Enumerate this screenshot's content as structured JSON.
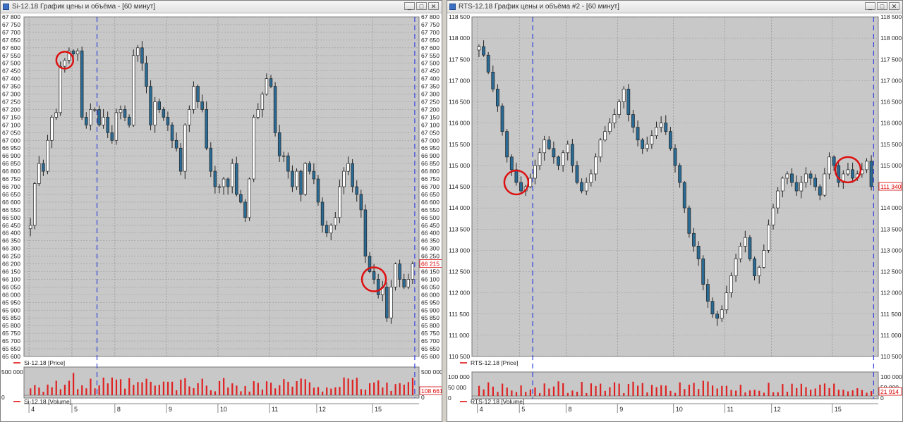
{
  "windows": [
    {
      "id": "si",
      "title": "Si-12.18 График цены и объёма - [60 минут]",
      "buttons": [
        "_",
        "□",
        "✕"
      ],
      "price_legend": "Si-12.18 [Price]",
      "volume_legend": "Si-12.18 [Volume]",
      "last_price_label": "66 215",
      "last_volume_label": "108 661",
      "volume_axis_labels": [
        "500 000",
        "0"
      ],
      "date_labels": [
        "4",
        "5",
        "8",
        "9",
        "10",
        "11",
        "12",
        "15"
      ],
      "colors": {
        "up": "#ffffff",
        "down": "#2a6b95",
        "volume": "#e02020",
        "session_line": "#3344dd",
        "circle": "#dd1111",
        "plot_bg": "#c8c8c8"
      }
    },
    {
      "id": "rts",
      "title": "RTS-12.18 График цены и объёма #2 - [60 минут]",
      "buttons": [
        "_",
        "□",
        "✕"
      ],
      "price_legend": "RTS-12.18 [Price]",
      "volume_legend": "RTS-12.18 [Volume]",
      "last_price_label": "111 340",
      "last_volume_label": "21 914",
      "volume_axis_labels": [
        "100 000",
        "50 000",
        "0"
      ],
      "date_labels": [
        "4",
        "5",
        "8",
        "9",
        "10",
        "11",
        "12",
        "15"
      ],
      "colors": {
        "up": "#ffffff",
        "down": "#2a6b95",
        "volume": "#e02020",
        "session_line": "#3344dd",
        "circle": "#dd1111",
        "plot_bg": "#c8c8c8"
      }
    }
  ],
  "chart_data": [
    {
      "type": "candlestick",
      "title": "Si-12.18 График цены и объёма - [60 минут]",
      "series_name": "Si-12.18 [Price]",
      "ylim": [
        65600,
        67800
      ],
      "y_ticks": [
        "67 800",
        "67 750",
        "67 700",
        "67 650",
        "67 600",
        "67 550",
        "67 500",
        "67 450",
        "67 400",
        "67 350",
        "67 300",
        "67 250",
        "67 200",
        "67 150",
        "67 100",
        "67 050",
        "67 000",
        "66 950",
        "66 900",
        "66 850",
        "66 800",
        "66 750",
        "66 700",
        "66 650",
        "66 600",
        "66 550",
        "66 500",
        "66 450",
        "66 400",
        "66 350",
        "66 300",
        "66 250",
        "66 200",
        "66 150",
        "66 100",
        "66 050",
        "66 000",
        "65 950",
        "65 900",
        "65 850",
        "65 800",
        "65 750",
        "65 700",
        "65 650",
        "65 600"
      ],
      "x_labels": [
        "4",
        "5",
        "8",
        "9",
        "10",
        "11",
        "12",
        "15"
      ],
      "highlight_index": [
        8,
        80
      ],
      "closes": [
        66450,
        66720,
        66850,
        66800,
        67000,
        67150,
        67180,
        67480,
        67520,
        67580,
        67560,
        67580,
        67150,
        67100,
        67200,
        67200,
        67100,
        67150,
        67050,
        67000,
        67180,
        67200,
        67150,
        67100,
        67550,
        67600,
        67500,
        67350,
        67100,
        67250,
        67200,
        67150,
        67100,
        67000,
        66950,
        66800,
        67100,
        67200,
        67350,
        67250,
        67200,
        66950,
        66800,
        66700,
        66700,
        66750,
        66700,
        66850,
        66650,
        66600,
        66500,
        66750,
        67150,
        67200,
        67300,
        67400,
        67350,
        67050,
        66900,
        66900,
        66800,
        66700,
        66800,
        66650,
        66850,
        66800,
        66750,
        66600,
        66450,
        66400,
        66450,
        66500,
        66700,
        66800,
        66850,
        66700,
        66650,
        66550,
        66250,
        66150,
        66100,
        66000,
        66050,
        65850,
        66050,
        66200,
        66100,
        66050,
        66100,
        66200
      ]
    },
    {
      "type": "candlestick",
      "title": "RTS-12.18 График цены и объёма #2 - [60 минут]",
      "series_name": "RTS-12.18 [Price]",
      "ylim": [
        110500,
        118500
      ],
      "y_ticks": [
        "118 500",
        "118 000",
        "117 500",
        "117 000",
        "116 500",
        "116 000",
        "115 500",
        "115 000",
        "114 500",
        "114 000",
        "113 500",
        "113 000",
        "112 500",
        "112 000",
        "111 500",
        "111 000",
        "110 500"
      ],
      "x_labels": [
        "4",
        "5",
        "8",
        "9",
        "10",
        "11",
        "12",
        "15"
      ],
      "highlight_index": [
        8,
        79
      ],
      "closes": [
        117800,
        117600,
        117200,
        116800,
        116400,
        115800,
        115200,
        114900,
        114600,
        114400,
        114500,
        114700,
        115000,
        115300,
        115600,
        115400,
        115200,
        115000,
        115300,
        115500,
        115000,
        114600,
        114400,
        114600,
        114800,
        115200,
        115600,
        115800,
        116000,
        116200,
        116500,
        116800,
        116200,
        115900,
        115600,
        115400,
        115500,
        115700,
        115900,
        116000,
        115800,
        115400,
        115000,
        114600,
        114000,
        113400,
        113100,
        112800,
        112200,
        111800,
        111500,
        111400,
        111600,
        112000,
        112400,
        112800,
        113100,
        113300,
        112800,
        112400,
        112600,
        113000,
        113600,
        114000,
        114400,
        114700,
        114800,
        114600,
        114400,
        114600,
        114800,
        114700,
        114500,
        114300,
        114800,
        115200,
        115000,
        114600,
        114800,
        114900,
        114700,
        114800,
        114900,
        115100,
        114500
      ]
    }
  ]
}
